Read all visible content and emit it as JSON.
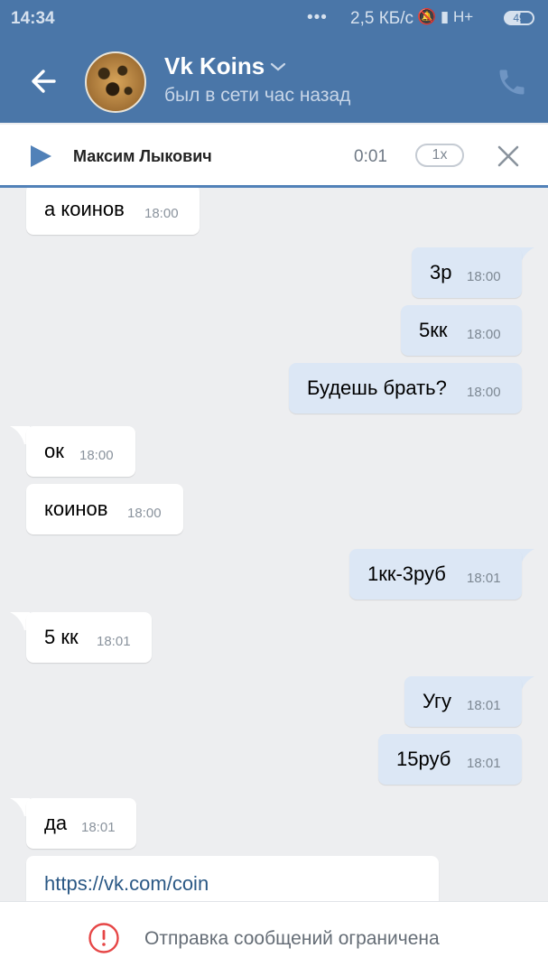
{
  "status_bar": {
    "time": "14:34",
    "dots": "•••",
    "speed": "2,5 КБ/с",
    "icons": "🔕 ▮ H+",
    "battery": "49"
  },
  "header": {
    "title": "Vk Koins",
    "status": "был в сети час назад"
  },
  "audio_player": {
    "author": "Максим Лыкович",
    "time": "0:01",
    "speed": "1x"
  },
  "messages": [
    {
      "dir": "in",
      "text": "а коинов",
      "time": "18:00"
    },
    {
      "dir": "out",
      "text": "3р",
      "time": "18:00"
    },
    {
      "dir": "out",
      "text": "5кк",
      "time": "18:00"
    },
    {
      "dir": "out",
      "text": "Будешь брать?",
      "time": "18:00"
    },
    {
      "dir": "in",
      "text": "ок",
      "time": "18:00"
    },
    {
      "dir": "in",
      "text": "коинов",
      "time": "18:00"
    },
    {
      "dir": "out",
      "text": "1кк-3руб",
      "time": "18:01"
    },
    {
      "dir": "in",
      "text": "5 кк",
      "time": "18:01"
    },
    {
      "dir": "out",
      "text": "Угу",
      "time": "18:01"
    },
    {
      "dir": "out",
      "text": "15руб",
      "time": "18:01"
    },
    {
      "dir": "in",
      "text": "да",
      "time": "18:01"
    }
  ],
  "link_message": {
    "text": "https://vk.com/coin"
  },
  "bottom_bar": {
    "text": "Отправка сообщений ограничена"
  },
  "colors": {
    "header": "#4a76a8",
    "background": "#edeef0",
    "outgoing_bubble": "#dce7f5",
    "incoming_bubble": "#ffffff",
    "accent": "#5181b8",
    "warning": "#e64646"
  }
}
